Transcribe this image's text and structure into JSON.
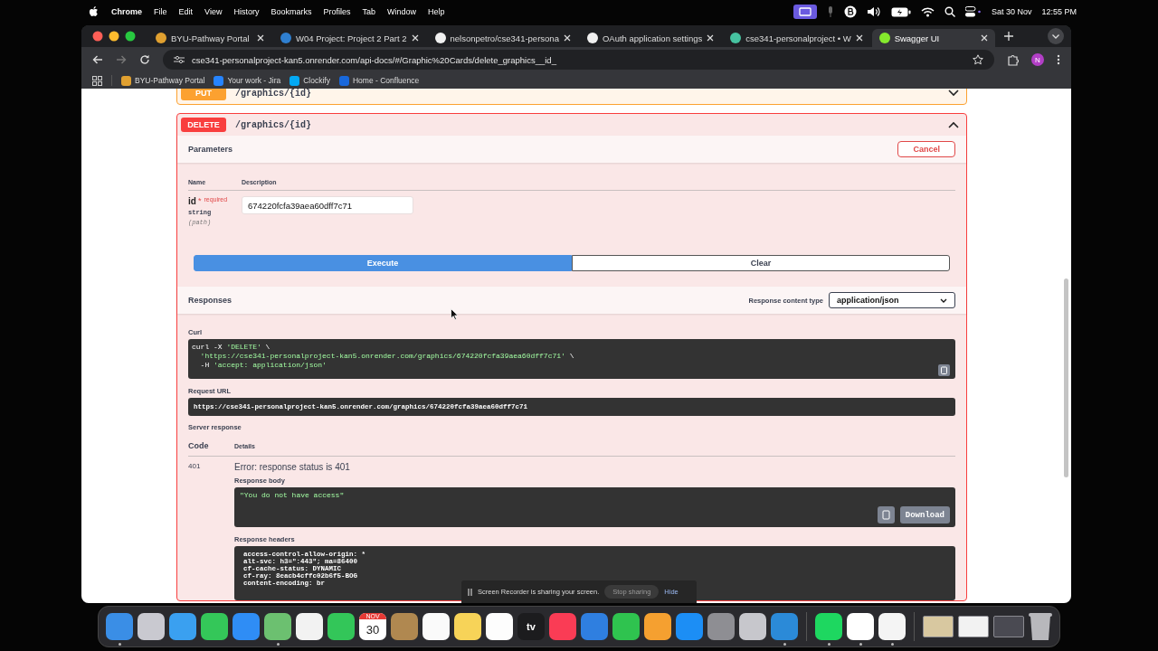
{
  "menu_bar": {
    "app": "Chrome",
    "items": [
      "File",
      "Edit",
      "View",
      "History",
      "Bookmarks",
      "Profiles",
      "Tab",
      "Window",
      "Help"
    ],
    "date": "Sat 30 Nov",
    "time": "12:55 PM"
  },
  "browser": {
    "tabs": [
      {
        "title": "BYU-Pathway Portal",
        "selected": false,
        "color": "#e0a030"
      },
      {
        "title": "W04 Project: Project 2 Part 2",
        "selected": false,
        "color": "#2f7fd0"
      },
      {
        "title": "nelsonpetro/cse341-persona",
        "selected": false,
        "color": "#f0f0f0"
      },
      {
        "title": "OAuth application settings",
        "selected": false,
        "color": "#f0f0f0"
      },
      {
        "title": "cse341-personalproject • W",
        "selected": false,
        "color": "#46c2a0"
      },
      {
        "title": "Swagger UI",
        "selected": true,
        "color": "#85ea2d"
      }
    ],
    "url": "cse341-personalproject-kan5.onrender.com/api-docs/#/Graphic%20Cards/delete_graphics__id_",
    "profile": "N",
    "bookmarks": [
      {
        "title": "BYU-Pathway Portal",
        "color": "#e0a030"
      },
      {
        "title": "Your work - Jira",
        "color": "#2684ff"
      },
      {
        "title": "Clockify",
        "color": "#03a9f4"
      },
      {
        "title": "Home - Confluence",
        "color": "#1868db"
      }
    ]
  },
  "swagger": {
    "operations": [
      {
        "kind": "put",
        "method": "PUT",
        "path": "/graphics/{id}",
        "expanded": false
      },
      {
        "kind": "delete",
        "method": "DELETE",
        "path": "/graphics/{id}",
        "expanded": true
      }
    ],
    "details": {
      "parameters_title": "Parameters",
      "cancel": "Cancel",
      "columns": [
        "Name",
        "Description"
      ],
      "params": [
        {
          "name": "id",
          "star": "*",
          "required": "required",
          "type": "string",
          "location": "(path)",
          "value": "674220fcfa39aea60dff7c71"
        }
      ],
      "execute": "Execute",
      "clear": "Clear",
      "responses_title": "Responses",
      "content_type_label": "Response content type",
      "content_type": "application/json",
      "curl_label": "Curl",
      "curl": [
        [
          {
            "kind": "plain",
            "text": "curl -X "
          },
          {
            "kind": "string",
            "text": "'DELETE'"
          },
          {
            "kind": "plain",
            "text": " \\"
          }
        ],
        [
          {
            "kind": "string",
            "text": "'https://cse341-personalproject-kan5.onrender.com/graphics/674220fcfa39aea60dff7c71'"
          },
          {
            "kind": "plain",
            "text": " \\"
          }
        ],
        [
          {
            "kind": "plain",
            "text": "-H "
          },
          {
            "kind": "string",
            "text": "'accept: application/json'"
          }
        ]
      ],
      "request_url_label": "Request URL",
      "request_url": "https://cse341-personalproject-kan5.onrender.com/graphics/674220fcfa39aea60dff7c71",
      "server_response_label": "Server response",
      "response_columns": [
        "Code",
        "Details"
      ],
      "response": {
        "code": "401",
        "error": "Error: response status is 401",
        "body_label": "Response body",
        "body": "\"You do not have access\"",
        "download": "Download",
        "headers_label": "Response headers",
        "headers": [
          "access-control-allow-origin: *",
          "alt-svc: h3=\":443\"; ma=86400",
          "cf-cache-status: DYNAMIC",
          "cf-ray: 8eacb4cffc02b6f5-BOG",
          "content-encoding: br"
        ]
      }
    }
  },
  "screen_share": {
    "message": "Screen Recorder is sharing your screen.",
    "stop": "Stop sharing",
    "hide": "Hide"
  },
  "dock": {
    "groups": [
      [
        {
          "kind": "app",
          "color": "#3a8ee6",
          "running": true
        },
        {
          "kind": "app",
          "color": "#c9c9d0",
          "running": false
        },
        {
          "kind": "app",
          "color": "#3aa0f0",
          "running": false
        },
        {
          "kind": "app",
          "color": "#34c759",
          "running": false
        },
        {
          "kind": "app",
          "color": "#2f8df5",
          "running": false
        },
        {
          "kind": "app",
          "color": "#6cc070",
          "running": true
        },
        {
          "kind": "app",
          "color": "#f2f2f2",
          "running": false
        },
        {
          "kind": "app",
          "color": "#33c659",
          "running": false
        },
        {
          "kind": "calendar",
          "month": "NOV",
          "day": "30",
          "color": "#ffffff",
          "running": false
        },
        {
          "kind": "app",
          "color": "#b08850",
          "running": false
        },
        {
          "kind": "app",
          "color": "#fafafa",
          "running": false
        },
        {
          "kind": "app",
          "color": "#f7d358",
          "running": false
        },
        {
          "kind": "app",
          "color": "#fdfdfd",
          "running": false
        },
        {
          "kind": "tv",
          "label": "tv",
          "color": "#1c1c1e",
          "running": false
        },
        {
          "kind": "app",
          "color": "#fa3c55",
          "running": false
        },
        {
          "kind": "app",
          "color": "#2f7fe0",
          "running": false
        },
        {
          "kind": "app",
          "color": "#2fc34f",
          "running": false
        },
        {
          "kind": "app",
          "color": "#f5a030",
          "running": false
        },
        {
          "kind": "app",
          "color": "#1c8ef5",
          "running": false
        },
        {
          "kind": "app",
          "color": "#8e8e93",
          "running": false
        },
        {
          "kind": "app",
          "color": "#c7c7cc",
          "running": false
        },
        {
          "kind": "app",
          "color": "#2b8ad8",
          "running": true
        }
      ],
      [
        {
          "kind": "app",
          "color": "#1ed760",
          "running": true
        },
        {
          "kind": "app",
          "color": "#ffffff",
          "running": true
        },
        {
          "kind": "app",
          "color": "#f4f4f4",
          "running": true
        }
      ],
      [
        {
          "kind": "window",
          "color": "#d8c8a0",
          "running": false
        },
        {
          "kind": "window",
          "color": "#f2f2f2",
          "running": false
        },
        {
          "kind": "window",
          "color": "#4a4a52",
          "running": false
        },
        {
          "kind": "trash",
          "color": "#b8b8bc",
          "running": false
        }
      ]
    ]
  }
}
